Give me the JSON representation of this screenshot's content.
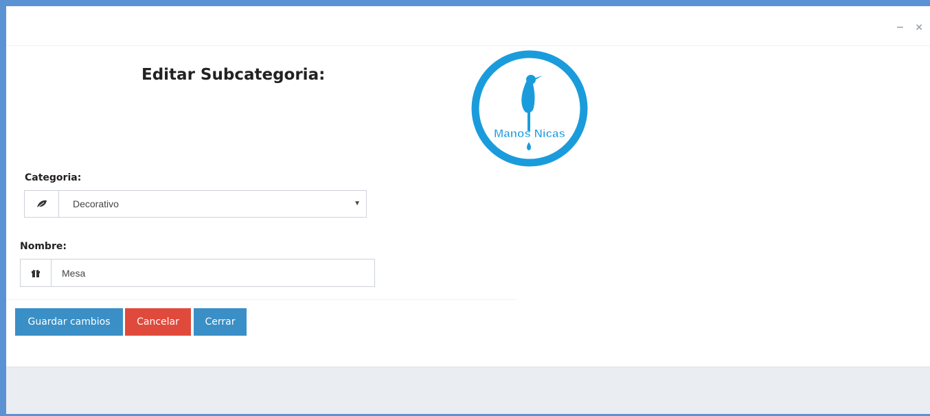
{
  "window_controls": {
    "minimize": "−",
    "close": "×"
  },
  "modal": {
    "title": "Editar Subcategoria:",
    "logo": {
      "text": "Manos Nicas",
      "icon": "bird-logo",
      "color": "#1a9cdc"
    }
  },
  "form": {
    "categoria": {
      "label": "Categoria:",
      "icon": "leaf-icon",
      "selected": "Decorativo"
    },
    "nombre": {
      "label": "Nombre:",
      "icon": "gift-icon",
      "value": "Mesa"
    }
  },
  "buttons": {
    "save": "Guardar cambios",
    "cancel": "Cancelar",
    "close": "Cerrar"
  },
  "colors": {
    "primary": "#3a8fc6",
    "danger": "#e04a3c",
    "frame": "#5b92d3"
  }
}
